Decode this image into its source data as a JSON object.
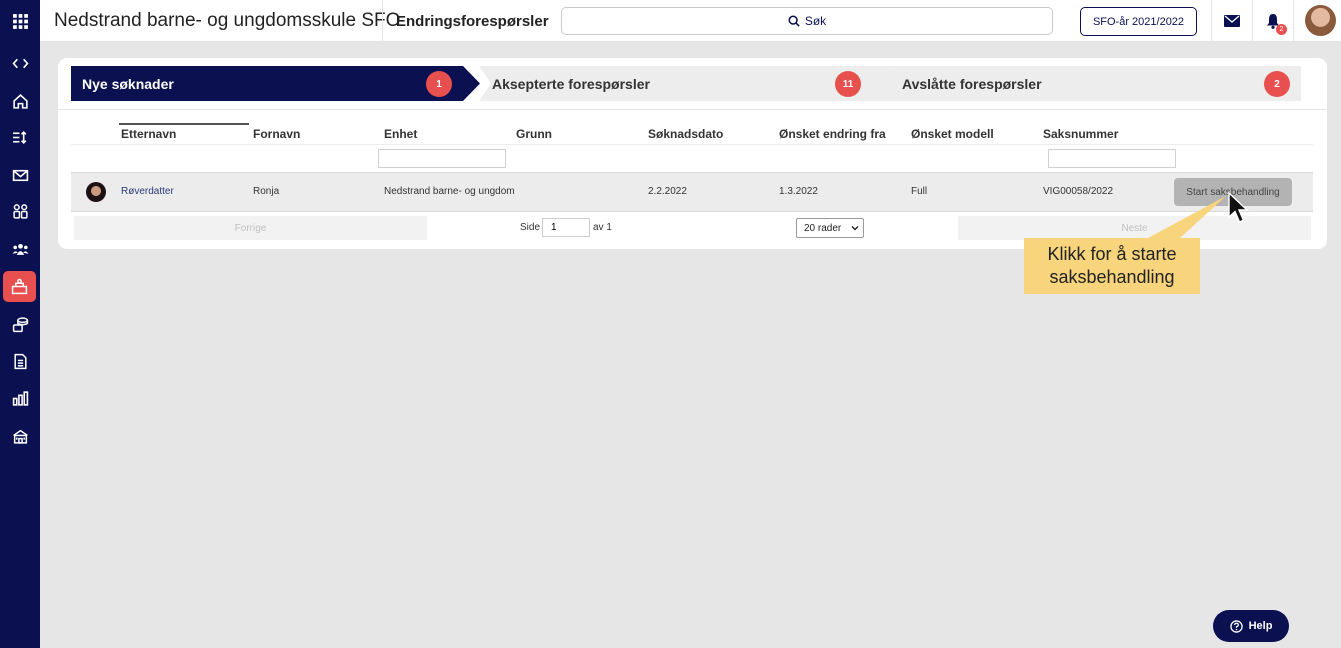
{
  "app": {
    "title": "Nedstrand barne- og ungdomsskule SFO",
    "page_title": "Endringsforespørsler",
    "search_placeholder": "Søk",
    "year_button": "SFO-år 2021/2022",
    "notification_count": "2"
  },
  "sidebar": {
    "icons": [
      "grid-icon",
      "code-icon",
      "home-icon",
      "sort-icon",
      "mail-icon",
      "children-icon",
      "group-icon",
      "application-icon",
      "money-icon",
      "document-icon",
      "stats-icon",
      "school-icon"
    ],
    "active_index": 7
  },
  "steps": [
    {
      "label": "Nye søknader",
      "count": "1",
      "active": true
    },
    {
      "label": "Aksepterte forespørsler",
      "count": "11",
      "active": false
    },
    {
      "label": "Avslåtte forespørsler",
      "count": "2",
      "active": false
    }
  ],
  "table": {
    "columns": [
      "Etternavn",
      "Fornavn",
      "Enhet",
      "Grunn",
      "Søknadsdato",
      "Ønsket endring fra",
      "Ønsket modell",
      "Saksnummer"
    ],
    "rows": [
      {
        "etternavn": "Røverdatter",
        "fornavn": "Ronja",
        "enhet": "Nedstrand barne- og ungdom",
        "grunn": "",
        "soknadsdato": "2.2.2022",
        "endring_fra": "1.3.2022",
        "modell": "Full",
        "saksnummer": "VIG00058/2022",
        "action": "Start saksbehandling"
      }
    ]
  },
  "pager": {
    "prev": "Forrige",
    "next": "Neste",
    "page_label": "Side",
    "page_value": "1",
    "of_label": "av 1",
    "rows_option": "20 rader"
  },
  "tooltip": {
    "line1": "Klikk for å starte",
    "line2": "saksbehandling"
  },
  "help_label": "Help",
  "colors": {
    "navy": "#0a1050",
    "accent_red": "#e8504f",
    "tooltip_yellow": "#f8d57c",
    "step_inactive": "#ededed"
  }
}
